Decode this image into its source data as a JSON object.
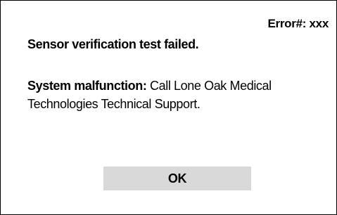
{
  "dialog": {
    "error_code": "Error#: xxx",
    "title": "Sensor verification test failed.",
    "message_label": "System malfunction:",
    "message_text": " Call Lone Oak Medical Technologies Technical Support.",
    "ok_label": "OK"
  },
  "colors": {
    "background": "#ffffff",
    "border": "#000000",
    "button_background": "#d9d9d9",
    "text": "#000000"
  }
}
